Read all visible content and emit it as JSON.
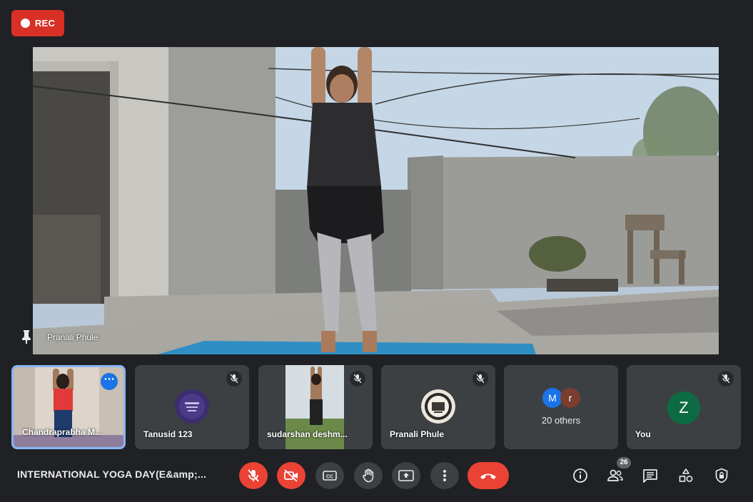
{
  "recording": {
    "label": "REC"
  },
  "main_speaker": {
    "name": "Pranali Phule"
  },
  "participants": [
    {
      "name": "Chandraprabha M...",
      "muted": false
    },
    {
      "name": "Tanusid 123",
      "muted": true
    },
    {
      "name": "sudarshan deshm...",
      "muted": true
    },
    {
      "name": "Pranali Phule",
      "muted": true
    },
    {
      "name": "You",
      "muted": true,
      "initial": "Z"
    }
  ],
  "others": {
    "label": "20 others",
    "initials": [
      "M",
      "r"
    ]
  },
  "meeting": {
    "title": "INTERNATIONAL YOGA DAY(E&amp;..."
  },
  "people_count": "26",
  "controls": [
    "mic-off",
    "camera-off",
    "captions",
    "raise-hand",
    "present",
    "more-options",
    "end-call"
  ],
  "right_controls": [
    "info",
    "people",
    "chat",
    "activities",
    "host-controls"
  ],
  "colors": {
    "background": "#202124",
    "tile": "#3c4043",
    "danger": "#ea4335",
    "active_border": "#8ab4f8"
  }
}
